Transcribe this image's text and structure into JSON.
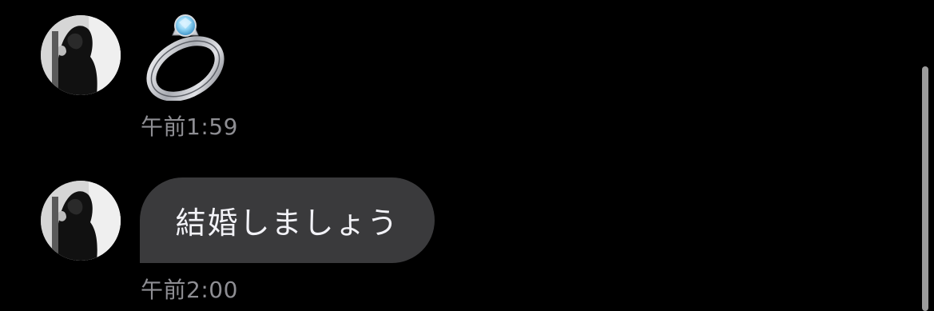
{
  "colors": {
    "background": "#000000",
    "bubble": "#3a3a3c",
    "bubble_text": "#f2f2f7",
    "timestamp": "#8e8e93",
    "scrollbar": "#9b9b9b"
  },
  "messages": [
    {
      "type": "emoji",
      "emoji_name": "ring-icon",
      "timestamp": "午前1:59"
    },
    {
      "type": "text",
      "text": "結婚しましょう",
      "timestamp": "午前2:00"
    }
  ]
}
